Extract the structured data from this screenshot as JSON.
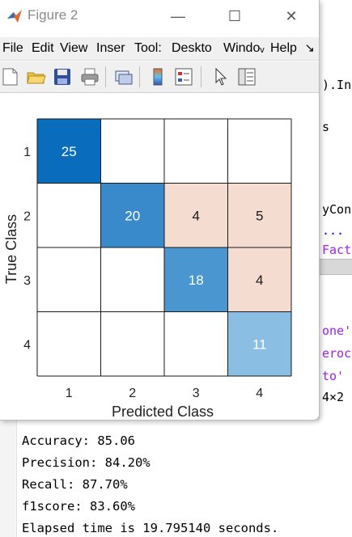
{
  "window": {
    "title": "Figure 2",
    "minimize_glyph": "—",
    "maximize_glyph": "☐",
    "close_glyph": "✕"
  },
  "menu": {
    "items": [
      "File",
      "Edit",
      "View",
      "Inser",
      "Tool:",
      "Deskto",
      "Windoᵥ",
      "Help"
    ],
    "overflow_glyph": "↘"
  },
  "toolbar": {
    "buttons": [
      "new-figure-icon",
      "open-file-icon",
      "save-icon",
      "print-icon",
      "link-plot-icon",
      "colorbar-icon",
      "legend-icon",
      "pointer-icon",
      "property-inspector-icon"
    ]
  },
  "chart_data": {
    "type": "heatmap",
    "xlabel": "Predicted Class",
    "ylabel": "True Class",
    "x_ticks": [
      "1",
      "2",
      "3",
      "4"
    ],
    "y_ticks": [
      "1",
      "2",
      "3",
      "4"
    ],
    "matrix": [
      [
        25,
        null,
        null,
        null
      ],
      [
        null,
        20,
        4,
        5
      ],
      [
        null,
        null,
        18,
        4
      ],
      [
        null,
        null,
        null,
        11
      ]
    ],
    "colors": {
      "diag_max": "#0a6cbd",
      "diag_light": "#8abfe3",
      "off_diag": "#f5dcd0",
      "grid": "#1a1a1a"
    }
  },
  "background_code": {
    "fragments": [
      ").In",
      "s",
      "yCon",
      "...",
      "Fact",
      "one'",
      "eroc",
      "to'",
      "4×2"
    ]
  },
  "console": {
    "lines": [
      "Accuracy: 85.06",
      "Precision: 84.20%",
      "Recall: 87.70%",
      "f1score: 83.60%",
      "Elapsed time is 19.795140 seconds."
    ]
  }
}
